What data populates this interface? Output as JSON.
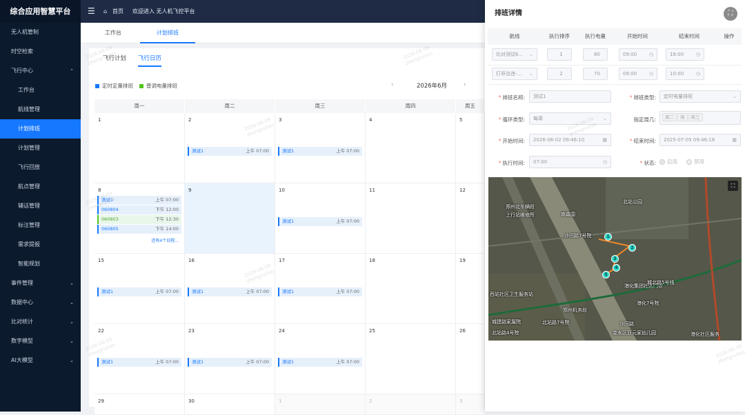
{
  "app": {
    "title": "综合应用智慧平台"
  },
  "sidebar": {
    "items": [
      {
        "label": "无人机管制",
        "level": 0
      },
      {
        "label": "时空检索",
        "level": 0
      },
      {
        "label": "飞行中心",
        "level": 0,
        "expanded": true
      },
      {
        "label": "工作台",
        "level": 1
      },
      {
        "label": "航线管理",
        "level": 1
      },
      {
        "label": "计划排班",
        "level": 1,
        "active": true
      },
      {
        "label": "计划管理",
        "level": 1
      },
      {
        "label": "飞行回放",
        "level": 1
      },
      {
        "label": "航点管理",
        "level": 1
      },
      {
        "label": "辅话管理",
        "level": 1
      },
      {
        "label": "标注管理",
        "level": 1
      },
      {
        "label": "需求提报",
        "level": 1
      },
      {
        "label": "智能规划",
        "level": 1
      },
      {
        "label": "事件管理",
        "level": 0,
        "collapsed": true
      },
      {
        "label": "数据中心",
        "level": 0,
        "collapsed": true
      },
      {
        "label": "比对统计",
        "level": 0,
        "collapsed": true
      },
      {
        "label": "数字模型",
        "level": 0,
        "collapsed": true
      },
      {
        "label": "AI大模型",
        "level": 0,
        "collapsed": true
      }
    ]
  },
  "topbar": {
    "home": "首页",
    "welcome": "欢迎进入 无人机飞控平台"
  },
  "page_tabs": [
    {
      "label": "工作台"
    },
    {
      "label": "计划排班",
      "active": true
    }
  ],
  "content_tabs": [
    {
      "label": "飞行计划"
    },
    {
      "label": "飞行日历",
      "active": true
    }
  ],
  "legend": [
    {
      "label": "定时定量排班",
      "color": "#1677ff"
    },
    {
      "label": "普调电量排班",
      "color": "#52c41a"
    }
  ],
  "calendar": {
    "month_label": "2026年6月",
    "prev": "‹",
    "next": "›",
    "weekdays": [
      "周一",
      "周二",
      "周三",
      "周四",
      "周五"
    ],
    "weeks": [
      [
        {
          "day": "1",
          "events": []
        },
        {
          "day": "2",
          "events": [
            {
              "name": "测试1",
              "time": "上午 07:00"
            }
          ]
        },
        {
          "day": "3",
          "events": [
            {
              "name": "测试1",
              "time": "上午 07:00"
            }
          ]
        },
        {
          "day": "4",
          "events": []
        },
        {
          "day": "5",
          "events": []
        }
      ],
      [
        {
          "day": "8",
          "events": [
            {
              "name": "测试1",
              "time": "上午 07:00"
            },
            {
              "name": "060804",
              "time": "下午 12:00"
            },
            {
              "name": "060803",
              "time": "下午 12:30",
              "green": true
            },
            {
              "name": "060805",
              "time": "下午 14:00"
            }
          ],
          "more": "还有4个日程..."
        },
        {
          "day": "9",
          "today": true,
          "events": []
        },
        {
          "day": "10",
          "events": [
            {
              "name": "测试1",
              "time": "上午 07:00"
            }
          ]
        },
        {
          "day": "11",
          "events": []
        },
        {
          "day": "12",
          "events": []
        }
      ],
      [
        {
          "day": "15",
          "events": [
            {
              "name": "测试1",
              "time": "上午 07:00"
            }
          ]
        },
        {
          "day": "16",
          "events": [
            {
              "name": "测试1",
              "time": "上午 07:00"
            }
          ]
        },
        {
          "day": "17",
          "events": [
            {
              "name": "测试1",
              "time": "上午 07:00"
            }
          ]
        },
        {
          "day": "18",
          "events": []
        },
        {
          "day": "19",
          "events": []
        }
      ],
      [
        {
          "day": "22",
          "events": [
            {
              "name": "测试1",
              "time": "上午 07:00"
            }
          ]
        },
        {
          "day": "23",
          "events": [
            {
              "name": "测试1",
              "time": "上午 07:00"
            }
          ]
        },
        {
          "day": "24",
          "events": [
            {
              "name": "测试1",
              "time": "上午 07:00"
            }
          ]
        },
        {
          "day": "25",
          "events": []
        },
        {
          "day": "26",
          "events": []
        }
      ],
      [
        {
          "day": "29",
          "events": []
        },
        {
          "day": "30",
          "events": []
        },
        {
          "day": "1",
          "other": true,
          "events": []
        },
        {
          "day": "2",
          "other": true,
          "events": []
        },
        {
          "day": "3",
          "other": true,
          "events": []
        }
      ]
    ]
  },
  "drawer": {
    "title": "排班详情",
    "close_icon": "⛶",
    "table": {
      "headers": [
        "航线",
        "执行排序",
        "执行电量",
        "开始时间",
        "结束时间",
        "操作"
      ],
      "rows": [
        {
          "route": "比对测试6...",
          "order": "1",
          "power": "80",
          "start": "09:00",
          "end": "18:00"
        },
        {
          "route": "打非治违-...",
          "order": "2",
          "power": "70",
          "start": "09:00",
          "end": "10:00"
        }
      ]
    },
    "form": {
      "name_label": "排班名称:",
      "name_value": "测试1",
      "type_label": "排班类型:",
      "type_value": "定时电量排班",
      "loop_label": "循环类型:",
      "loop_value": "每周",
      "cycle_label": "指定周几:",
      "cycle_tags": [
        "周二",
        "周",
        "周三"
      ],
      "start_label": "开始时间:",
      "start_value": "2026-06-02 09:46:10",
      "end_label": "结束时间:",
      "end_value": "2025-07-05 09:46:16",
      "exec_label": "执行时间:",
      "exec_value": "07:00",
      "status_label": "状态:",
      "status_on": "启用",
      "status_off": "禁用"
    },
    "map": {
      "labels": [
        "郑州北车辆段",
        "上行站维修所",
        "北站公园",
        "南森国",
        "沙回路7号院",
        "港化集团社区门诊",
        "港化7号院",
        "西站社区卫生服务站",
        "郑州机务段",
        "北站路7号院",
        "沙回路",
        "金水区亚元家幼儿园",
        "港化社区服务",
        "城建路家属院",
        "北站路4号院",
        "城北路5号线"
      ],
      "markers": [
        "1",
        "2",
        "3",
        "4",
        "5"
      ]
    }
  },
  "watermark": {
    "line1": "2026-06-09",
    "line2": "zhengruitao"
  }
}
